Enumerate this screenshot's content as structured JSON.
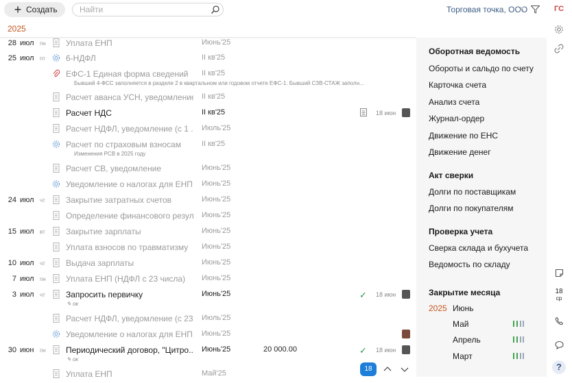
{
  "toolbar": {
    "create_label": "Создать",
    "search_placeholder": "Найти",
    "org_name": "Торговая точка, ООО",
    "org_clear": "×",
    "user_initials": "ГС"
  },
  "year_label": "2025",
  "tasks": [
    {
      "day": "28",
      "month": "июл",
      "weekday": "пн",
      "title": "Уплата ЕНП",
      "period": "Июнь'25"
    },
    {
      "day": "25",
      "month": "июл",
      "weekday": "пт",
      "title": "6-НДФЛ",
      "period": "II кв'25"
    },
    {
      "title": "ЕФС-1 Единая форма сведений",
      "period": "II кв'25",
      "sub": "Бывший 4-ФСС заполняется в разделе 2 в квартальном или годовом отчете ЕФС-1. Бывший СЗВ-СТАЖ заполн..."
    },
    {
      "title": "Расчет аванса УСН, уведомление",
      "period": "II кв'25"
    },
    {
      "title": "Расчет НДС",
      "period": "II кв'25",
      "date": "18 июн"
    },
    {
      "title": "Расчет НДФЛ, уведомление (с 1 ...",
      "period": "Июль'25"
    },
    {
      "title": "Расчет по страховым взносам",
      "period": "II кв'25",
      "sub": "Изменения РСВ в 2025 году"
    },
    {
      "title": "Расчет СВ, уведомление",
      "period": "Июнь'25"
    },
    {
      "title": "Уведомление о налогах для ЕНП",
      "period": "Июнь'25"
    },
    {
      "day": "24",
      "month": "июл",
      "weekday": "чт",
      "title": "Закрытие затратных счетов",
      "period": "Июнь'25"
    },
    {
      "title": "Определение финансового резул...",
      "period": "Июнь'25"
    },
    {
      "day": "15",
      "month": "июл",
      "weekday": "вт",
      "title": "Закрытие зарплаты",
      "period": "Июнь'25"
    },
    {
      "title": "Уплата взносов по травматизму",
      "period": "Июнь'25"
    },
    {
      "day": "10",
      "month": "июл",
      "weekday": "чт",
      "title": "Выдача зарплаты",
      "period": "Июнь'25"
    },
    {
      "day": "7",
      "month": "июл",
      "weekday": "пн",
      "title": "Уплата ЕНП (НДФЛ с 23 числа)",
      "period": "Июнь'25"
    },
    {
      "day": "3",
      "month": "июл",
      "weekday": "чт",
      "title": "Запросить первичку",
      "period": "Июнь'25",
      "note": "ок",
      "check": "✓",
      "date": "18 июн"
    },
    {
      "title": "Расчет НДФЛ, уведомление (с 23...",
      "period": "Июль'25"
    },
    {
      "title": "Уведомление о налогах для ЕНП",
      "period": "Июнь'25"
    },
    {
      "day": "30",
      "month": "июн",
      "weekday": "пн",
      "title": "Периодический договор, \"Цитро...",
      "period": "Июнь'25",
      "amount": "20 000.00",
      "note": "ок",
      "check": "✓",
      "date": "18 июн"
    },
    {
      "title": "Уплата ЕНП",
      "period": "Май'25"
    }
  ],
  "pager": {
    "page": "18"
  },
  "right_panel": {
    "sections": [
      {
        "title": "Оборотная ведомость",
        "items": [
          "Обороты и сальдо по счету",
          "Карточка счета",
          "Анализ счета",
          "Журнал-ордер",
          "Движение по ЕНС",
          "Движение денег"
        ]
      },
      {
        "title": "Акт сверки",
        "items": [
          "Долги по поставщикам",
          "Долги по покупателям"
        ]
      },
      {
        "title": "Проверка учета",
        "items": [
          "Сверка склада и бухучета",
          "Ведомость по складу"
        ]
      },
      {
        "title": "Закрытие месяца"
      }
    ],
    "closing": {
      "year": "2025",
      "months": [
        "Июнь",
        "Май",
        "Апрель",
        "Март"
      ]
    }
  },
  "rail": {
    "calendar_day": "18",
    "calendar_weekday": "ср",
    "help": "?"
  },
  "colors": {
    "accent": "#c4531d",
    "link": "#3b5b85",
    "ok": "#2a9b46",
    "badge": "#1e7fd8"
  }
}
